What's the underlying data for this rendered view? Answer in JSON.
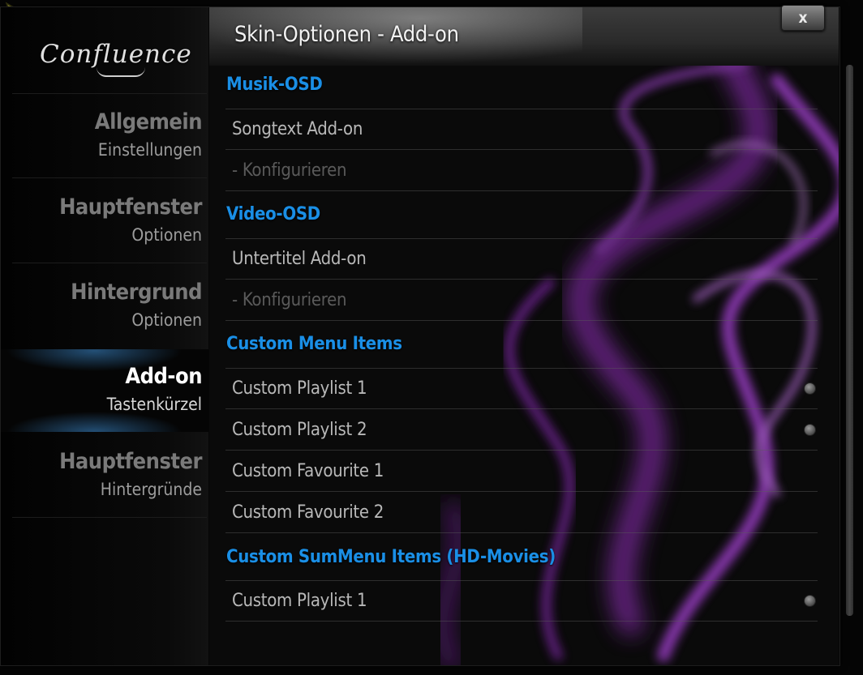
{
  "app": {
    "logo": "Confluence"
  },
  "dialog": {
    "title": "Skin-Optionen - Add-on",
    "close_label": "x"
  },
  "sidebar": {
    "items": [
      {
        "title": "Allgemein",
        "subtitle": "Einstellungen"
      },
      {
        "title": "Hauptfenster",
        "subtitle": "Optionen"
      },
      {
        "title": "Hintergrund",
        "subtitle": "Optionen"
      },
      {
        "title": "Add-on",
        "subtitle": "Tastenkürzel",
        "active": true
      },
      {
        "title": "Hauptfenster",
        "subtitle": "Hintergründe"
      }
    ]
  },
  "sections": {
    "musik": {
      "header": "Musik-OSD",
      "items": [
        {
          "label": "Songtext Add-on"
        },
        {
          "label": "- Konfigurieren",
          "disabled": true
        }
      ]
    },
    "video": {
      "header": "Video-OSD",
      "items": [
        {
          "label": "Untertitel Add-on"
        },
        {
          "label": "- Konfigurieren",
          "disabled": true
        }
      ]
    },
    "custom_menu": {
      "header": "Custom Menu Items",
      "items": [
        {
          "label": "Custom Playlist 1",
          "radio": true
        },
        {
          "label": "Custom Playlist 2",
          "radio": true
        },
        {
          "label": "Custom Favourite 1"
        },
        {
          "label": "Custom Favourite 2"
        }
      ]
    },
    "custom_submenu": {
      "header": "Custom SumMenu Items (HD-Movies)",
      "items": [
        {
          "label": "Custom Playlist 1",
          "radio": true
        }
      ]
    }
  },
  "colors": {
    "accent": "#1a8fe6",
    "active_glow": "#3c8cd2",
    "smoke": "#8a2fb0"
  },
  "icons": {
    "pointer": "mouse-pointer-icon",
    "close": "close-icon",
    "radio": "radio-dot-icon"
  }
}
